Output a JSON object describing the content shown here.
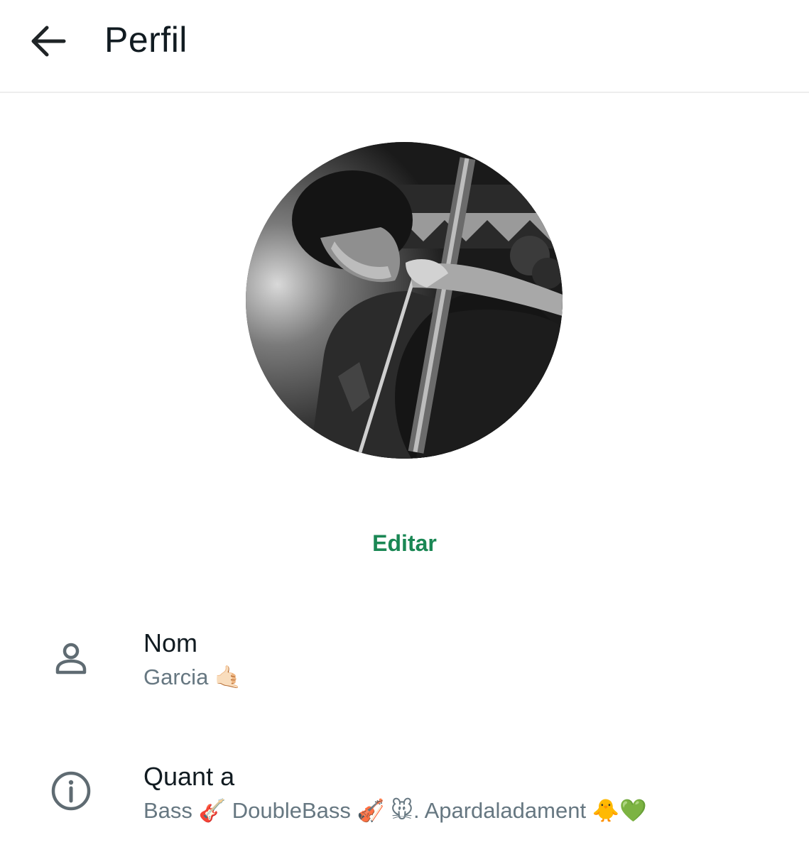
{
  "header": {
    "title": "Perfil",
    "back_icon": "arrow-left-icon"
  },
  "profile": {
    "photo_description": "black-and-white photo of person playing double bass",
    "edit_label": "Editar",
    "accent_color": "#1a8754"
  },
  "fields": {
    "name": {
      "icon": "person-icon",
      "label": "Nom",
      "value": "Garcia 🤙🏻"
    },
    "about": {
      "icon": "info-icon",
      "label": "Quant a",
      "value": "Bass 🎸 DoubleBass 🎻 🐭. Apardaladament 🐥💚"
    }
  }
}
